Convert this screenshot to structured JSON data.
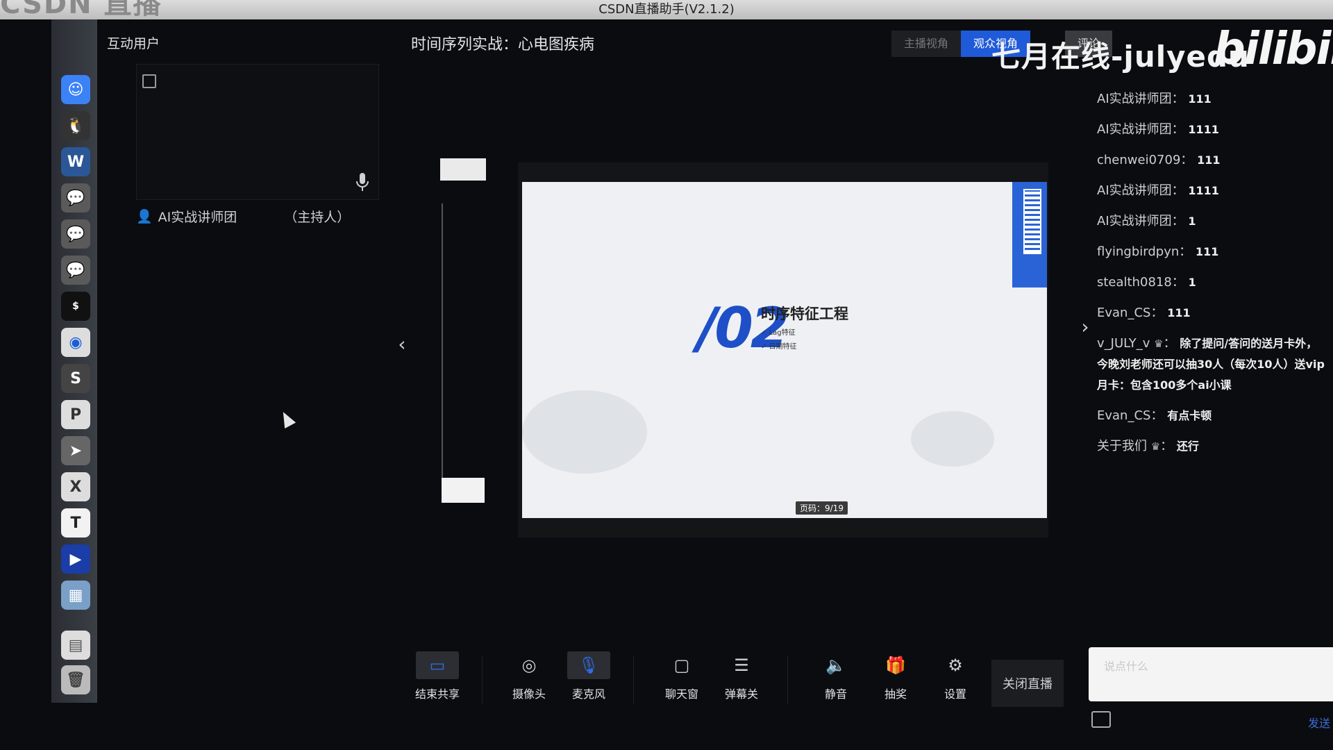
{
  "window": {
    "title": "CSDN直播助手(V2.1.2)",
    "logo_fragment": "CSDN 直播"
  },
  "left_panel": {
    "title": "互动用户",
    "host_name": "AI实战讲师团",
    "host_role": "（主持人）"
  },
  "session_title": "时间序列实战：心电图疾病",
  "view_tabs": {
    "host": "主播视角",
    "audience": "观众视角",
    "comment": "评论"
  },
  "watermark": "七月在线-julyedu",
  "bilibili": "bilibili",
  "slide": {
    "number": "/02",
    "heading": "时序特征工程",
    "bullets": [
      "✓ Lag特征",
      "✓ 日期特征"
    ],
    "page_label": "页码：9/19"
  },
  "chat": [
    {
      "name": "AI实战讲师团",
      "content": "111"
    },
    {
      "name": "AI实战讲师团",
      "content": "1111"
    },
    {
      "name": "chenwei0709",
      "content": "111"
    },
    {
      "name": "AI实战讲师团",
      "content": "1111"
    },
    {
      "name": "AI实战讲师团",
      "content": "1"
    },
    {
      "name": "flyingbirdpyn",
      "content": "111"
    },
    {
      "name": "stealth0818",
      "content": "1"
    },
    {
      "name": "Evan_CS",
      "content": "111"
    },
    {
      "name": "v_JULY_v",
      "content": "除了提问/答问的送月卡外，今晚刘老师还可以抽30人（每次10人）送vip月卡：包含100多个ai小课",
      "crown": true
    },
    {
      "name": "Evan_CS",
      "content": "有点卡顿"
    },
    {
      "name": "关于我们",
      "content": "还行",
      "crown": true
    }
  ],
  "toolbar": {
    "end_share": "结束共享",
    "camera": "摄像头",
    "microphone": "麦克风",
    "chat_window": "聊天窗",
    "danmaku": "弹幕关",
    "mute": "静音",
    "lottery": "抽奖",
    "settings": "设置",
    "close_live": "关闭直播"
  },
  "chat_input": {
    "placeholder": "说点什么",
    "send": "发送"
  },
  "colors": {
    "accent": "#1f5ad8",
    "background": "#0b0c10"
  }
}
